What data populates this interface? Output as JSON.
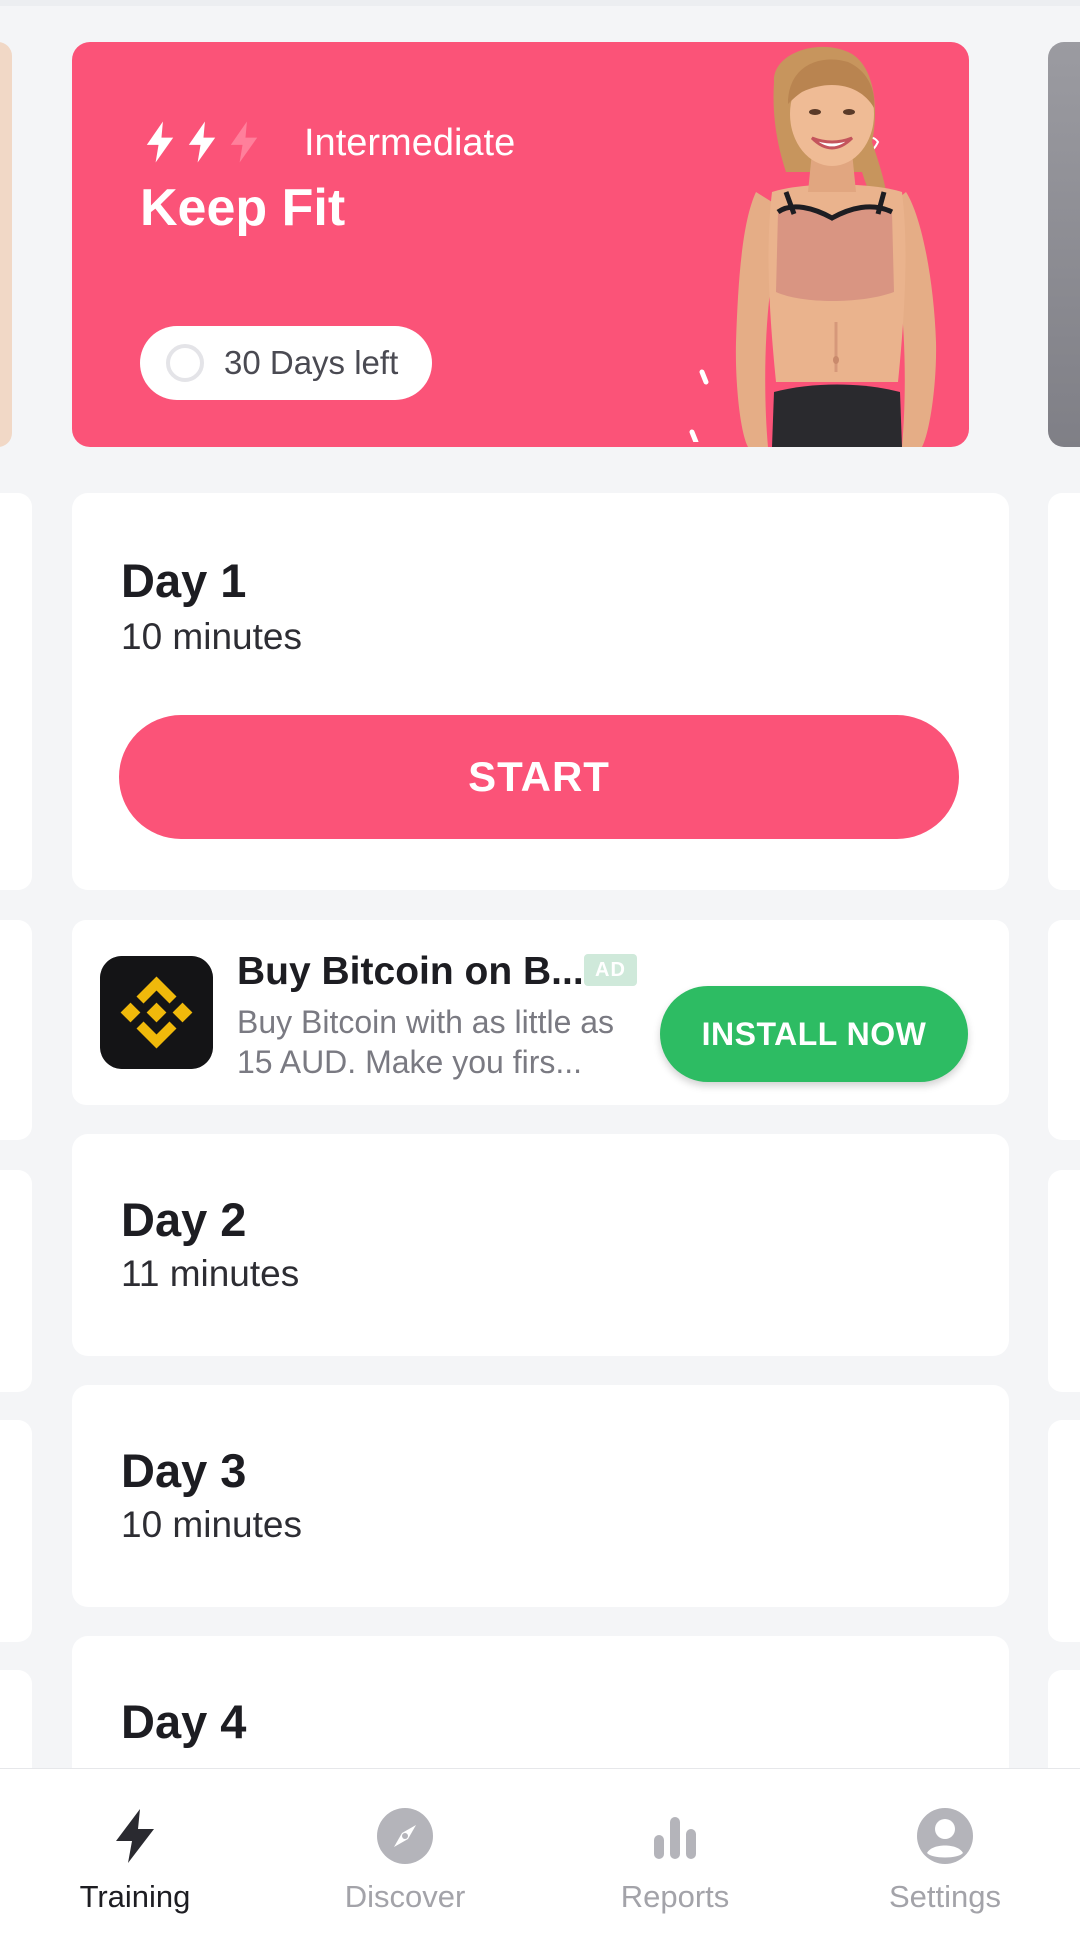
{
  "hero": {
    "level": "Intermediate",
    "title": "Keep Fit",
    "days_left": "30 Days left",
    "intensity_level": 2,
    "intensity_max": 3
  },
  "days": [
    {
      "title": "Day 1",
      "duration": "10 minutes",
      "start_label": "START"
    },
    {
      "title": "Day 2",
      "duration": "11 minutes"
    },
    {
      "title": "Day 3",
      "duration": "10 minutes"
    },
    {
      "title": "Day 4"
    }
  ],
  "ad": {
    "title": "Buy Bitcoin on B...",
    "badge": "AD",
    "description": "Buy Bitcoin with as little as 15 AUD. Make you firs...",
    "cta": "INSTALL NOW",
    "icon": "binance-logo-icon"
  },
  "nav": [
    {
      "label": "Training",
      "icon": "bolt-icon",
      "active": true
    },
    {
      "label": "Discover",
      "icon": "compass-icon",
      "active": false
    },
    {
      "label": "Reports",
      "icon": "bar-chart-icon",
      "active": false
    },
    {
      "label": "Settings",
      "icon": "user-icon",
      "active": false
    }
  ],
  "colors": {
    "accent": "#fb5378",
    "install": "#2dbc63",
    "background": "#f4f5f7"
  }
}
